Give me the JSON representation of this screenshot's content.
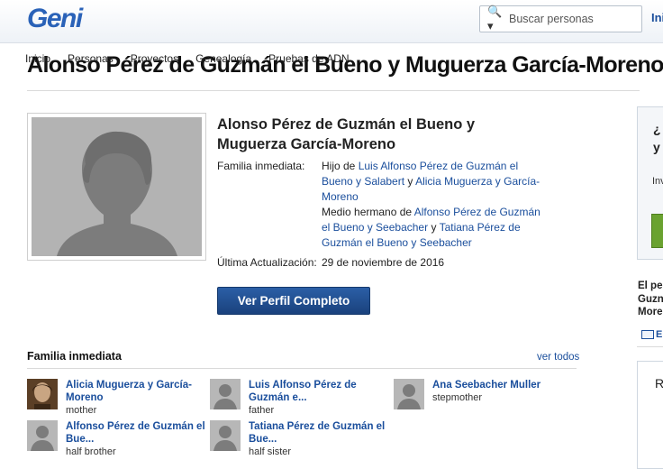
{
  "header": {
    "logo": "Geni",
    "search_placeholder": "Buscar personas",
    "right_link": "Ini"
  },
  "nav": [
    "Inicio",
    "Personas",
    "Proyectos",
    "Genealogía",
    "Pruebas de ADN"
  ],
  "page_title": "Alonso Pérez de Guzmán el Bueno y Muguerza García-Moreno",
  "profile": {
    "name": "Alonso Pérez de Guzmán el Bueno y Muguerza García-Moreno",
    "family_label": "Familia inmediata:",
    "son_of_prefix": "Hijo de",
    "father_link": "Luis Alfonso Pérez de Guzmán el Bueno y Salabert",
    "and1": "y",
    "mother_link": "Alicia Muguerza y García-Moreno",
    "half_brother_prefix": "Medio hermano de",
    "half_sib1_link": "Alfonso Pérez de Guzmán el Bueno y Seebacher",
    "and2": "y",
    "half_sib2_link": "Tatiana Pérez de Guzmán el Bueno y Seebacher",
    "updated_label": "Última Actualización:",
    "updated_value": "29 de noviembre de 2016",
    "view_full_button": "Ver Perfil Completo"
  },
  "family": {
    "title": "Familia inmediata",
    "see_all": "ver todos",
    "members": [
      {
        "name": "Alicia Muguerza y García-Moreno",
        "relation": "mother"
      },
      {
        "name": "Luis Alfonso Pérez de Guzmán e...",
        "relation": "father"
      },
      {
        "name": "Ana Seebacher Muller",
        "relation": "stepmother"
      },
      {
        "name": "Alfonso Pérez de Guzmán el Bue...",
        "relation": "half brother"
      },
      {
        "name": "Tatiana Pérez de Guzmán el Bue...",
        "relation": "half sister"
      }
    ]
  },
  "sidebar": {
    "q_line1": "¿",
    "q_line2": "y",
    "inv": "Inv",
    "text_line1": "El pe",
    "text_line2": "Guzn",
    "text_line3": "More",
    "mail": "E",
    "box2_letter": "R"
  },
  "colors": {
    "link": "#1a4e9c",
    "button": "#1f4a8c",
    "green": "#6aa230"
  }
}
